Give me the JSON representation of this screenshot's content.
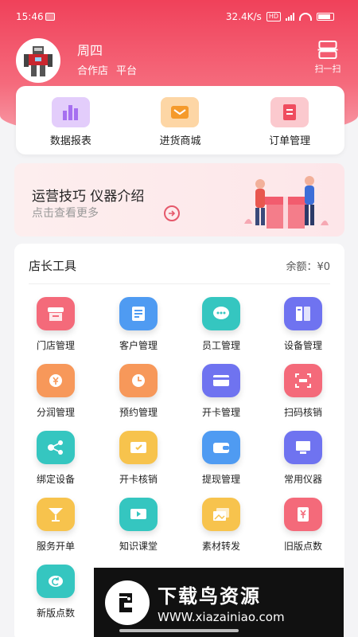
{
  "status_bar": {
    "time": "15:46",
    "network_speed": "32.4K/s",
    "hd_badge": "HD",
    "net_type": "4G"
  },
  "user": {
    "name": "周四",
    "tags": [
      "合作店",
      "平台"
    ]
  },
  "scan": {
    "label": "扫一扫"
  },
  "quick_actions": [
    {
      "label": "数据报表",
      "icon": "bar-chart-icon",
      "color": "#c9a4f6"
    },
    {
      "label": "进货商城",
      "icon": "mail-bag-icon",
      "color": "#f9b86b"
    },
    {
      "label": "订单管理",
      "icon": "clipboard-icon",
      "color": "#f47b85"
    }
  ],
  "banner": {
    "title": "运营技巧 仪器介绍",
    "subtitle": "点击查看更多"
  },
  "tools": {
    "title": "店长工具",
    "balance": "余额：¥0",
    "items": [
      {
        "label": "门店管理",
        "icon": "store-icon",
        "color": "#f46a7a"
      },
      {
        "label": "客户管理",
        "icon": "document-icon",
        "color": "#4f9bf2"
      },
      {
        "label": "员工管理",
        "icon": "chat-bubble-icon",
        "color": "#35c6c0"
      },
      {
        "label": "设备管理",
        "icon": "device-icon",
        "color": "#6f73f0"
      },
      {
        "label": "分润管理",
        "icon": "yuan-coin-icon",
        "color": "#f7985a"
      },
      {
        "label": "预约管理",
        "icon": "clock-icon",
        "color": "#f7985a"
      },
      {
        "label": "开卡管理",
        "icon": "card-icon",
        "color": "#6f73f0"
      },
      {
        "label": "扫码核销",
        "icon": "scan-code-icon",
        "color": "#f46a7a"
      },
      {
        "label": "绑定设备",
        "icon": "link-icon",
        "color": "#35c6c0"
      },
      {
        "label": "开卡核销",
        "icon": "ticket-icon",
        "color": "#f7c34d"
      },
      {
        "label": "提现管理",
        "icon": "wallet-icon",
        "color": "#4f9bf2"
      },
      {
        "label": "常用仪器",
        "icon": "monitor-icon",
        "color": "#6f73f0"
      },
      {
        "label": "服务开单",
        "icon": "cocktail-icon",
        "color": "#f7c34d"
      },
      {
        "label": "知识课堂",
        "icon": "video-play-icon",
        "color": "#35c6c0"
      },
      {
        "label": "素材转发",
        "icon": "image-stack-icon",
        "color": "#f7c34d"
      },
      {
        "label": "旧版点数",
        "icon": "yuan-doc-icon",
        "color": "#f46a7a"
      },
      {
        "label": "新版点数",
        "icon": "refresh-icon",
        "color": "#35c6c0"
      }
    ]
  },
  "watermark": {
    "title": "下载鸟资源",
    "url": "WWW.xiazainiao.com"
  }
}
